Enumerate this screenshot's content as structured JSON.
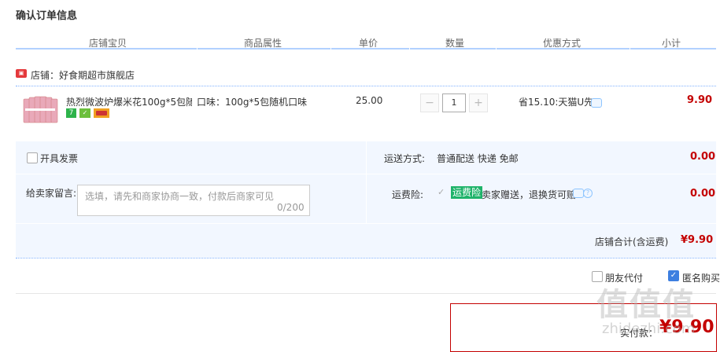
{
  "page_title": "确认订单信息",
  "headers": [
    "店铺宝贝",
    "商品属性",
    "单价",
    "数量",
    "优惠方式",
    "小计"
  ],
  "shop": {
    "name": "店铺：好食期超市旗舰店",
    "icon": "shop-icon"
  },
  "item": {
    "title": "热烈微波炉爆米花100g*5包随…",
    "attr": "口味：100g*5包随机口味",
    "price": "25.00",
    "quantity": "1",
    "minus": "−",
    "plus": "+",
    "discount": "省15.10:天猫U先",
    "subtotal": "9.90"
  },
  "invoice": {
    "label": "开具发票"
  },
  "shipping": {
    "label": "运送方式:",
    "value": "普通配送 快递 免邮",
    "amount": "0.00"
  },
  "message": {
    "label": "给卖家留言:",
    "placeholder": "选填，请先和商家协商一致，付款后商家可见",
    "count": "0/200"
  },
  "insurance": {
    "label": "运费险:",
    "tag": "运费险",
    "text": "卖家赠送，退换货可赔",
    "amount": "0.00"
  },
  "shop_total": {
    "label": "店铺合计(含运费)",
    "value": "¥9.90"
  },
  "friend_pay": {
    "label": "朋友代付",
    "checked": false
  },
  "anonymous": {
    "label": "匿名购买",
    "checked": true
  },
  "payment": {
    "label": "实付款：",
    "value": "¥9.90"
  },
  "watermark": {
    "big": "值值值",
    "small": "zhidezhi.com"
  },
  "colors": {
    "accent_red": "#c40000",
    "header_line": "#b2d1ff",
    "row_bg": "#f2f7ff",
    "tag_green": "#1fb36a"
  }
}
